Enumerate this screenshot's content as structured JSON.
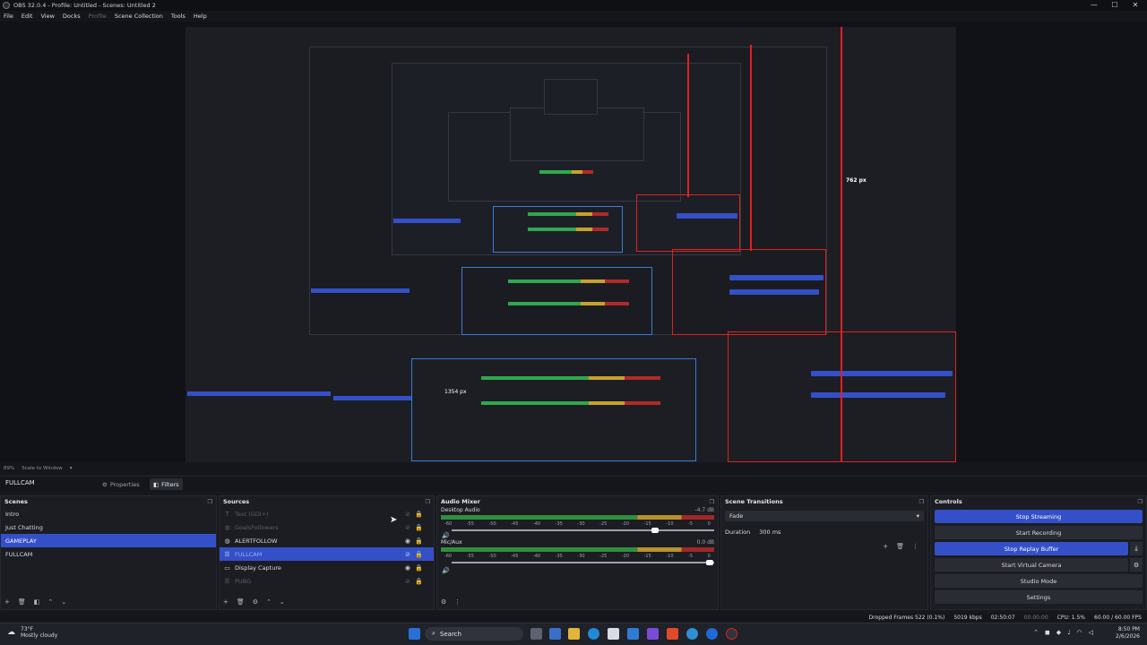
{
  "titlebar": {
    "title": "OBS 32.0.4 - Profile: Untitled - Scenes: Untitled 2",
    "minimize": "—",
    "maximize": "☐",
    "close": "✕"
  },
  "menu": [
    "File",
    "Edit",
    "View",
    "Docks",
    "Profile",
    "Scene Collection",
    "Tools",
    "Help"
  ],
  "preview": {
    "measure_label": "762 px",
    "measure_label2": "1354 px"
  },
  "scalebar": {
    "zoom": "89%",
    "scale_text": "Scale to Window"
  },
  "source_bar": {
    "selected_source": "FULLCAM",
    "properties": "Properties",
    "filters": "Filters"
  },
  "scenes": {
    "title": "Scenes",
    "items": [
      "Intro",
      "Just Chatting",
      "GAMEPLAY",
      "FULLCAM"
    ],
    "selected": "GAMEPLAY"
  },
  "sources": {
    "title": "Sources",
    "items": [
      {
        "name": "Text (GDI+)",
        "icon": "text-icon",
        "visible": false
      },
      {
        "name": "GoalsFollowers",
        "icon": "browser-icon",
        "visible": false
      },
      {
        "name": "ALERTFOLLOW",
        "icon": "browser-icon",
        "visible": true
      },
      {
        "name": "FULLCAM",
        "icon": "group-icon",
        "visible": false,
        "selected": true
      },
      {
        "name": "Display Capture",
        "icon": "monitor-icon",
        "visible": true
      },
      {
        "name": "PUBG",
        "icon": "list-icon",
        "visible": false
      }
    ]
  },
  "audio_mixer": {
    "title": "Audio Mixer",
    "channels": [
      {
        "name": "Desktop Audio",
        "db": "-4.7 dB",
        "volume_fraction": 0.8
      },
      {
        "name": "Mic/Aux",
        "db": "0.0 dB",
        "volume_fraction": 1.0
      }
    ],
    "ticks": [
      "-60",
      "-55",
      "-50",
      "-45",
      "-40",
      "-35",
      "-30",
      "-25",
      "-20",
      "-15",
      "-10",
      "-5",
      "0"
    ]
  },
  "scene_transitions": {
    "title": "Scene Transitions",
    "transition": "Fade",
    "duration_label": "Duration",
    "duration": "300 ms"
  },
  "controls": {
    "title": "Controls",
    "buttons": [
      {
        "label": "Stop Streaming",
        "active": true
      },
      {
        "label": "Start Recording",
        "active": false
      },
      {
        "label": "Stop Replay Buffer",
        "active": true
      },
      {
        "label": "Start Virtual Camera",
        "active": false
      },
      {
        "label": "Studio Mode",
        "active": false
      },
      {
        "label": "Settings",
        "active": false
      }
    ]
  },
  "status": {
    "dropped": "Dropped Frames 522 (0.1%)",
    "bitrate": "5019 kbps",
    "stream_time": "02:50:07",
    "rec_time": "00:00:00",
    "cpu": "CPU: 1.5%",
    "fps": "60.00 / 60.00 FPS"
  },
  "taskbar": {
    "weather_temp": "73°F",
    "weather_desc": "Mostly cloudy",
    "search": "Search",
    "time": "8:50 PM",
    "date": "2/6/2026"
  },
  "colors": {
    "accent": "#3450c8",
    "red_guide": "#e02020",
    "blue_guide": "#3a7bd5"
  }
}
